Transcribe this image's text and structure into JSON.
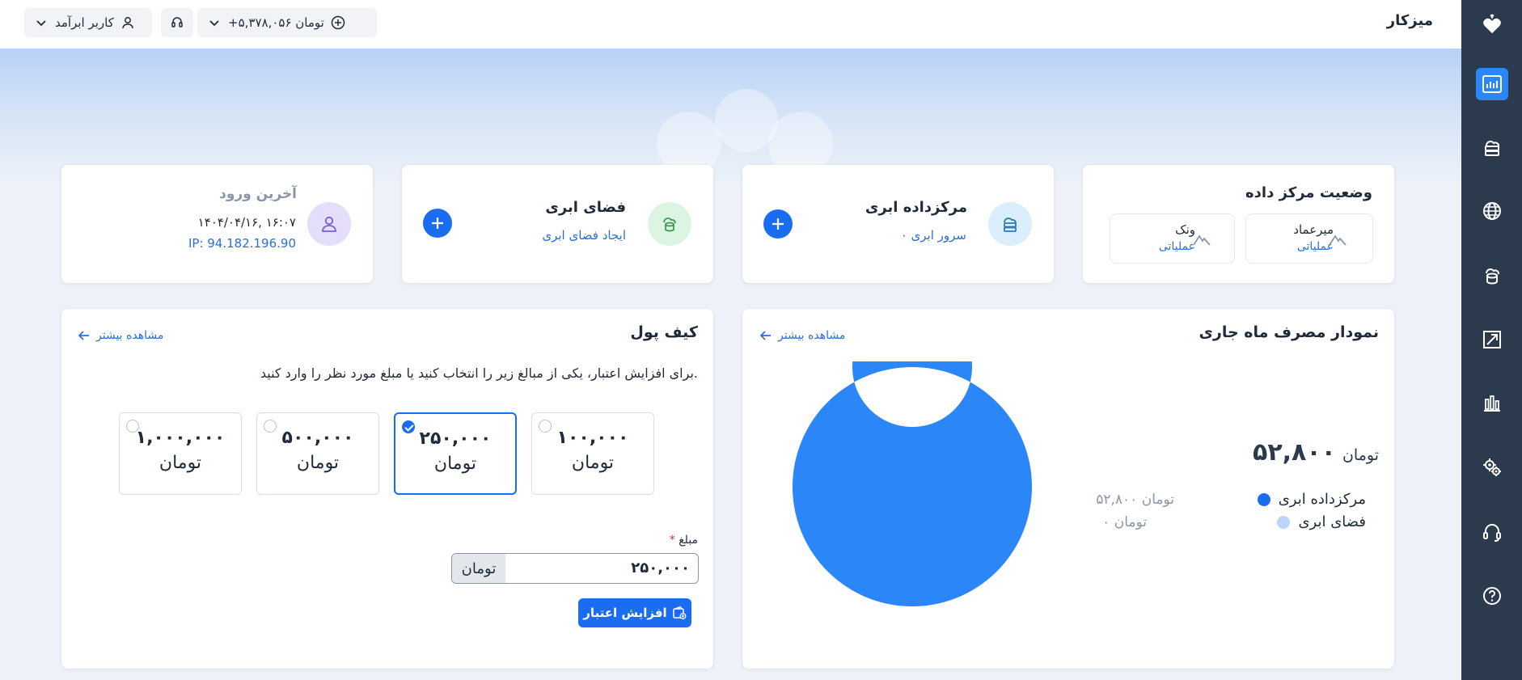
{
  "header": {
    "title": "میزکار",
    "balance": "+۵,۳۷۸,۰۵۶ تومان",
    "user": "کاربر ابرآمد"
  },
  "colors": {
    "accent": "#1a6cf0",
    "sidebar_bg": "#2b3a4d",
    "chart_primary": "#2b86f7",
    "chart_secondary": "#bcd6fb"
  },
  "sidebar": {
    "items": [
      {
        "icon": "dashboard-chart-icon",
        "active": true
      },
      {
        "icon": "cloud-server-icon"
      },
      {
        "icon": "globe-icon"
      },
      {
        "icon": "cloud-storage-icon"
      },
      {
        "icon": "resize-icon"
      },
      {
        "icon": "bar-chart-icon"
      },
      {
        "icon": "settings-gears-icon"
      },
      {
        "icon": "headset-icon"
      },
      {
        "icon": "help-icon"
      }
    ]
  },
  "datacenter_status": {
    "title": "وضعیت مرکز داده",
    "items": [
      {
        "name": "میرعماد",
        "state": "عملیاتی"
      },
      {
        "name": "ونک",
        "state": "عملیاتی"
      }
    ]
  },
  "cloud_datacenter": {
    "title": "مرکزداده ابری",
    "subtitle": "۰ سرور ابری"
  },
  "cloud_space": {
    "title": "فضای ابری",
    "subtitle": "ایجاد فضای ابری"
  },
  "last_login": {
    "title": "آخرین ورود",
    "datetime": "۱۴۰۴/۰۴/۱۶, ۱۶:۰۷",
    "ip": "IP: 94.182.196.90"
  },
  "usage_chart": {
    "title": "نمودار مصرف ماه جاری",
    "see_more": "مشاهده بیشتر",
    "total_value": "۵۲,۸۰۰",
    "total_unit": "تومان"
  },
  "chart_data": {
    "type": "pie",
    "categories": [
      "مرکزداده ابری",
      "فضای ابری"
    ],
    "values": [
      52800,
      0
    ],
    "value_labels": [
      "۵۲,۸۰۰ تومان",
      "۰ تومان"
    ],
    "colors": [
      "#2b86f7",
      "#bcd6fb"
    ],
    "donut": true
  },
  "wallet": {
    "title": "کیف پول",
    "see_more": "مشاهده بیشتر",
    "description": "برای افزایش اعتبار، یکی از مبالغ زیر را انتخاب کنید یا مبلغ مورد نظر را وارد کنید.",
    "options": [
      {
        "amount": "۱۰۰,۰۰۰",
        "unit": "تومان",
        "selected": false
      },
      {
        "amount": "۲۵۰,۰۰۰",
        "unit": "تومان",
        "selected": true
      },
      {
        "amount": "۵۰۰,۰۰۰",
        "unit": "تومان",
        "selected": false
      },
      {
        "amount": "۱,۰۰۰,۰۰۰",
        "unit": "تومان",
        "selected": false
      }
    ],
    "amount_label": "مبلغ",
    "required_mark": "*",
    "amount_value": "۲۵۰,۰۰۰",
    "amount_unit": "تومان",
    "submit_label": "افزایش اعتبار"
  }
}
